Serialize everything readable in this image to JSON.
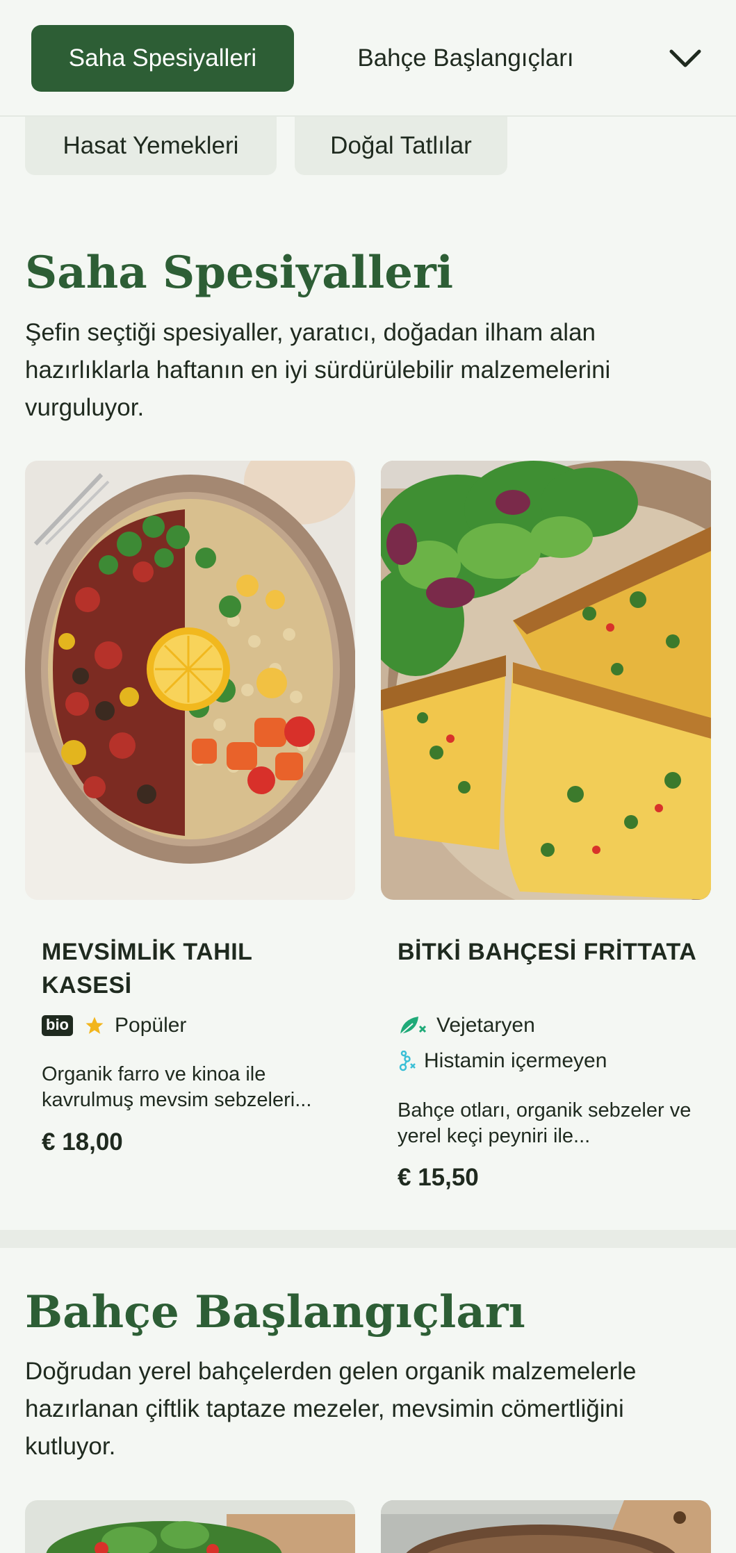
{
  "nav": {
    "active_tab": "Saha Spesiyalleri",
    "second_tab": "Bahçe Başlangıçları",
    "more_icon": "chevron-down-icon",
    "chips": [
      "Hasat Yemekleri",
      "Doğal Tatlılar"
    ]
  },
  "sections": [
    {
      "title": "Saha Spesiyalleri",
      "description": "Şefin seçtiği spesiyaller, yaratıcı, doğadan ilham alan hazırlıklarla haftanın en iyi sürdürülebilir malzemelerini vurguluyor.",
      "items": [
        {
          "name": "MEVSİMLİK TAHIL KASESİ",
          "badge": "bio",
          "tags": [
            {
              "icon": "star-icon",
              "label": "Popüler"
            }
          ],
          "description": "Organik farro ve kinoa ile kavrulmuş mevsim sebzeleri...",
          "price": "€ 18,00"
        },
        {
          "name": "BİTKİ BAHÇESİ FRİTTATA",
          "tags": [
            {
              "icon": "leaf-icon",
              "label": "Vejetaryen"
            },
            {
              "icon": "histamine-free-icon",
              "label": "Histamin içermeyen"
            }
          ],
          "description": "Bahçe otları, organik sebzeler ve yerel keçi peyniri ile...",
          "price": "€ 15,50"
        }
      ]
    },
    {
      "title": "Bahçe Başlangıçları",
      "description": "Doğrudan yerel bahçelerden gelen organik malzemelerle hazırlanan çiftlik taptaze mezeler, mevsimin cömertliğini kutluyor."
    }
  ],
  "colors": {
    "brand_green": "#2d5e35",
    "background": "#f4f7f3",
    "star": "#f2b51c",
    "vegetarian_icon": "#1faa78",
    "histamine_icon": "#3bbfd6"
  }
}
